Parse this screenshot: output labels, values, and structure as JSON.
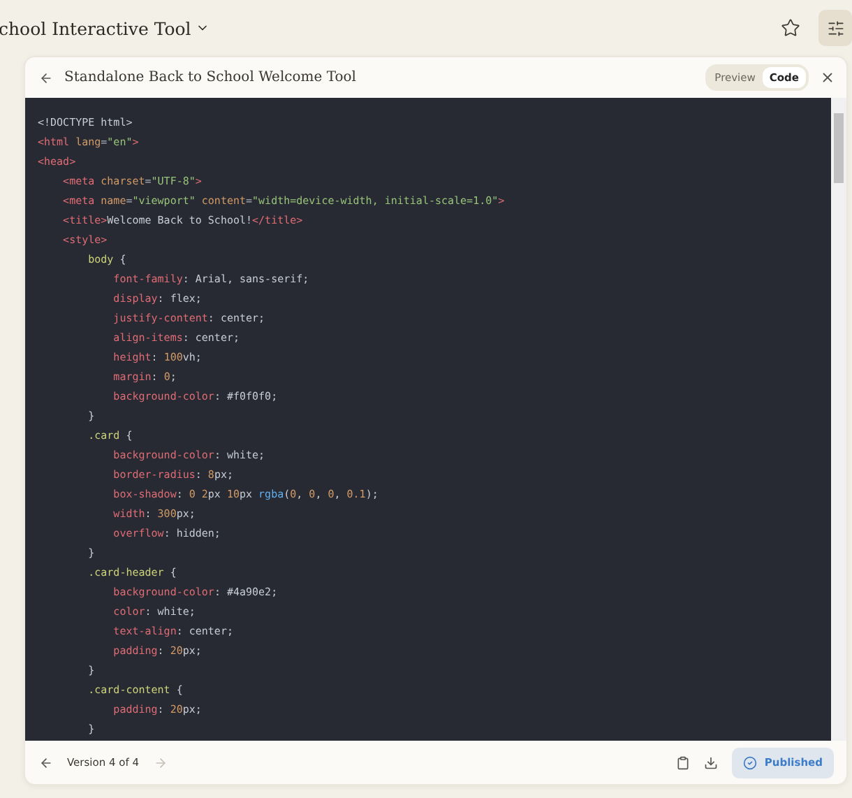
{
  "top_bar": {
    "title": "chool Interactive Tool"
  },
  "panel": {
    "title": "Standalone Back to School Welcome Tool",
    "view_tabs": [
      {
        "label": "Preview",
        "selected": false
      },
      {
        "label": "Code",
        "selected": true
      }
    ],
    "code_lines": [
      [
        {
          "kind": "doctype",
          "text": "<!DOCTYPE html>"
        }
      ],
      [
        {
          "kind": "tag",
          "text": "<html"
        },
        {
          "kind": "attr",
          "text": " lang"
        },
        {
          "kind": "punct",
          "text": "="
        },
        {
          "kind": "string",
          "text": "\"en\""
        },
        {
          "kind": "tag",
          "text": ">"
        }
      ],
      [
        {
          "kind": "tag",
          "text": "<head>"
        }
      ],
      [
        {
          "kind": "tag",
          "text": "    <meta"
        },
        {
          "kind": "attr",
          "text": " charset"
        },
        {
          "kind": "punct",
          "text": "="
        },
        {
          "kind": "string",
          "text": "\"UTF-8\""
        },
        {
          "kind": "tag",
          "text": ">"
        }
      ],
      [
        {
          "kind": "tag",
          "text": "    <meta"
        },
        {
          "kind": "attr",
          "text": " name"
        },
        {
          "kind": "punct",
          "text": "="
        },
        {
          "kind": "string",
          "text": "\"viewport\""
        },
        {
          "kind": "attr",
          "text": " content"
        },
        {
          "kind": "punct",
          "text": "="
        },
        {
          "kind": "string",
          "text": "\"width=device-width, initial-scale=1.0\""
        },
        {
          "kind": "tag",
          "text": ">"
        }
      ],
      [
        {
          "kind": "tag",
          "text": "    <title>"
        },
        {
          "kind": "text",
          "text": "Welcome Back to School!"
        },
        {
          "kind": "tag",
          "text": "</title>"
        }
      ],
      [
        {
          "kind": "tag",
          "text": "    <style>"
        }
      ],
      [
        {
          "kind": "selector",
          "text": "        body"
        },
        {
          "kind": "text",
          "text": " {"
        }
      ],
      [
        {
          "kind": "prop",
          "text": "            font-family"
        },
        {
          "kind": "text",
          "text": ": Arial, sans-serif;"
        }
      ],
      [
        {
          "kind": "prop",
          "text": "            display"
        },
        {
          "kind": "text",
          "text": ": flex;"
        }
      ],
      [
        {
          "kind": "prop",
          "text": "            justify-content"
        },
        {
          "kind": "text",
          "text": ": center;"
        }
      ],
      [
        {
          "kind": "prop",
          "text": "            align-items"
        },
        {
          "kind": "text",
          "text": ": center;"
        }
      ],
      [
        {
          "kind": "prop",
          "text": "            height"
        },
        {
          "kind": "text",
          "text": ": "
        },
        {
          "kind": "number",
          "text": "100"
        },
        {
          "kind": "text",
          "text": "vh;"
        }
      ],
      [
        {
          "kind": "prop",
          "text": "            margin"
        },
        {
          "kind": "text",
          "text": ": "
        },
        {
          "kind": "number",
          "text": "0"
        },
        {
          "kind": "text",
          "text": ";"
        }
      ],
      [
        {
          "kind": "prop",
          "text": "            background-color"
        },
        {
          "kind": "text",
          "text": ": #f0f0f0;"
        }
      ],
      [
        {
          "kind": "text",
          "text": "        }"
        }
      ],
      [
        {
          "kind": "selector",
          "text": "        .card"
        },
        {
          "kind": "text",
          "text": " {"
        }
      ],
      [
        {
          "kind": "prop",
          "text": "            background-color"
        },
        {
          "kind": "text",
          "text": ": white;"
        }
      ],
      [
        {
          "kind": "prop",
          "text": "            border-radius"
        },
        {
          "kind": "text",
          "text": ": "
        },
        {
          "kind": "number",
          "text": "8"
        },
        {
          "kind": "text",
          "text": "px;"
        }
      ],
      [
        {
          "kind": "prop",
          "text": "            box-shadow"
        },
        {
          "kind": "text",
          "text": ": "
        },
        {
          "kind": "number",
          "text": "0 2"
        },
        {
          "kind": "text",
          "text": "px "
        },
        {
          "kind": "number",
          "text": "10"
        },
        {
          "kind": "text",
          "text": "px "
        },
        {
          "kind": "func",
          "text": "rgba"
        },
        {
          "kind": "text",
          "text": "("
        },
        {
          "kind": "number",
          "text": "0"
        },
        {
          "kind": "text",
          "text": ", "
        },
        {
          "kind": "number",
          "text": "0"
        },
        {
          "kind": "text",
          "text": ", "
        },
        {
          "kind": "number",
          "text": "0"
        },
        {
          "kind": "text",
          "text": ", "
        },
        {
          "kind": "number",
          "text": "0.1"
        },
        {
          "kind": "text",
          "text": ");"
        }
      ],
      [
        {
          "kind": "prop",
          "text": "            width"
        },
        {
          "kind": "text",
          "text": ": "
        },
        {
          "kind": "number",
          "text": "300"
        },
        {
          "kind": "text",
          "text": "px;"
        }
      ],
      [
        {
          "kind": "prop",
          "text": "            overflow"
        },
        {
          "kind": "text",
          "text": ": hidden;"
        }
      ],
      [
        {
          "kind": "text",
          "text": "        }"
        }
      ],
      [
        {
          "kind": "selector",
          "text": "        .card-header"
        },
        {
          "kind": "text",
          "text": " {"
        }
      ],
      [
        {
          "kind": "prop",
          "text": "            background-color"
        },
        {
          "kind": "text",
          "text": ": #4a90e2;"
        }
      ],
      [
        {
          "kind": "prop",
          "text": "            color"
        },
        {
          "kind": "text",
          "text": ": white;"
        }
      ],
      [
        {
          "kind": "prop",
          "text": "            text-align"
        },
        {
          "kind": "text",
          "text": ": center;"
        }
      ],
      [
        {
          "kind": "prop",
          "text": "            padding"
        },
        {
          "kind": "text",
          "text": ": "
        },
        {
          "kind": "number",
          "text": "20"
        },
        {
          "kind": "text",
          "text": "px;"
        }
      ],
      [
        {
          "kind": "text",
          "text": "        }"
        }
      ],
      [
        {
          "kind": "selector",
          "text": "        .card-content"
        },
        {
          "kind": "text",
          "text": " {"
        }
      ],
      [
        {
          "kind": "prop",
          "text": "            padding"
        },
        {
          "kind": "text",
          "text": ": "
        },
        {
          "kind": "number",
          "text": "20"
        },
        {
          "kind": "text",
          "text": "px;"
        }
      ],
      [
        {
          "kind": "text",
          "text": "        }"
        }
      ]
    ],
    "footer": {
      "version": "Version 4 of 4",
      "next_disabled": true,
      "publish_button": "Published"
    }
  }
}
